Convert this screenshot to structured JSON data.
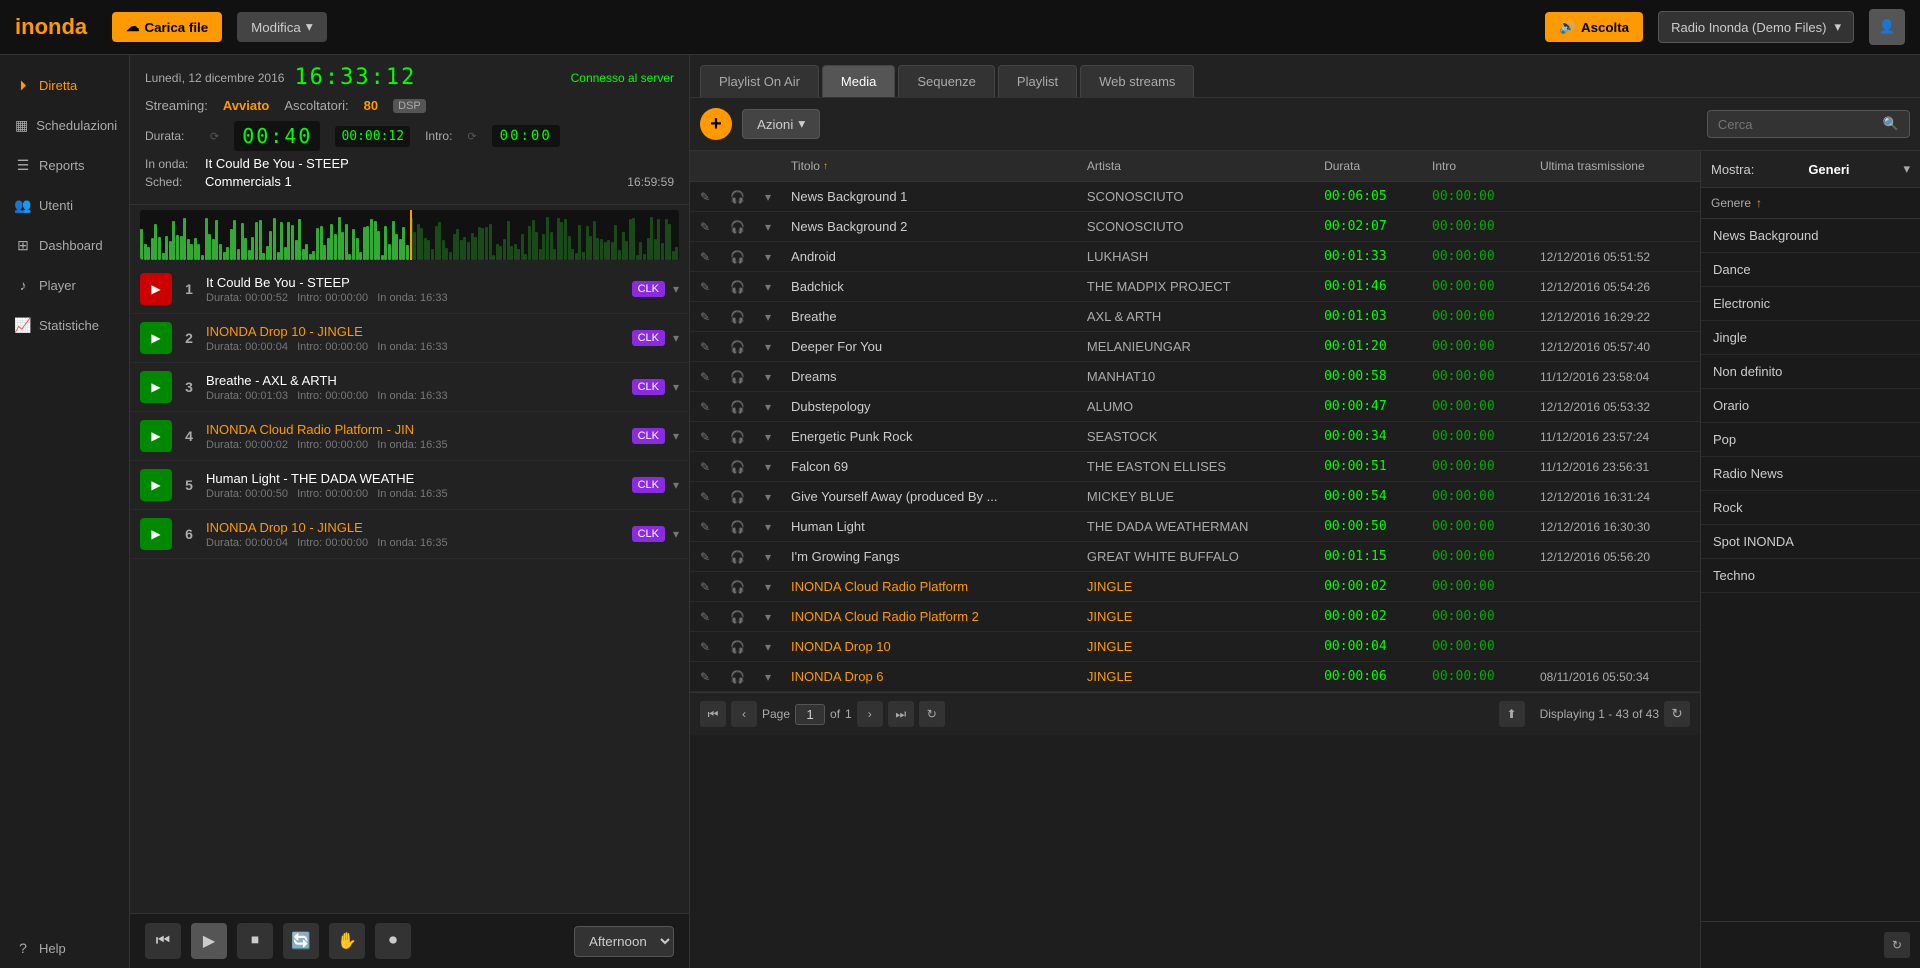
{
  "header": {
    "logo": "inonda",
    "carica_label": "Carica file",
    "modifica_label": "Modifica",
    "ascolta_label": "Ascolta",
    "radio_name": "Radio Inonda (Demo Files)"
  },
  "sidebar": {
    "items": [
      {
        "id": "diretta",
        "label": "Diretta",
        "icon": "▶",
        "active": true
      },
      {
        "id": "schedulazioni",
        "label": "Schedulazioni",
        "icon": "📅"
      },
      {
        "id": "reports",
        "label": "Reports",
        "icon": "📋"
      },
      {
        "id": "utenti",
        "label": "Utenti",
        "icon": "👥"
      },
      {
        "id": "dashboard",
        "label": "Dashboard",
        "icon": "📊"
      },
      {
        "id": "player",
        "label": "Player",
        "icon": "🎵"
      },
      {
        "id": "statistiche",
        "label": "Statistiche",
        "icon": "📈"
      },
      {
        "id": "help",
        "label": "Help",
        "icon": "❓"
      }
    ]
  },
  "left_panel": {
    "date": "Lunedì, 12 dicembre 2016",
    "time": "16:33:12",
    "connected_label": "Connesso al server",
    "streaming_label": "Streaming:",
    "streaming_status": "Avviato",
    "ascoltatori_label": "Ascoltatori:",
    "ascoltatori_val": "80",
    "dsp_label": "DSP",
    "durata_label": "Durata:",
    "durata_val": "00:40",
    "durata_small": "00:00:12",
    "intro_label": "Intro:",
    "intro_val": "00:00",
    "in_onda_label": "In onda:",
    "in_onda_val": "It Could Be You - STEEP",
    "sched_label": "Sched:",
    "sched_val": "Commercials 1",
    "sched_time": "16:59:59"
  },
  "playlist": {
    "items": [
      {
        "num": "1",
        "title": "It Could Be You - STEEP",
        "is_jingle": false,
        "duration": "00:00:52",
        "intro": "00:00:00",
        "on_air": "16:33",
        "has_clk": true,
        "playing": true
      },
      {
        "num": "2",
        "title": "INONDA Drop 10 - JINGLE",
        "is_jingle": true,
        "duration": "00:00:04",
        "intro": "00:00:00",
        "on_air": "16:33",
        "has_clk": true,
        "playing": false
      },
      {
        "num": "3",
        "title": "Breathe - AXL & ARTH",
        "is_jingle": false,
        "duration": "00:01:03",
        "intro": "00:00:00",
        "on_air": "16:33",
        "has_clk": true,
        "playing": false
      },
      {
        "num": "4",
        "title": "INONDA Cloud Radio Platform - JIN",
        "is_jingle": true,
        "duration": "00:00:02",
        "intro": "00:00:00",
        "on_air": "16:35",
        "has_clk": true,
        "playing": false
      },
      {
        "num": "5",
        "title": "Human Light - THE DADA WEATHE",
        "is_jingle": false,
        "duration": "00:00:50",
        "intro": "00:00:00",
        "on_air": "16:35",
        "has_clk": true,
        "playing": false
      },
      {
        "num": "6",
        "title": "INONDA Drop 10 - JINGLE",
        "is_jingle": true,
        "duration": "00:00:04",
        "intro": "00:00:00",
        "on_air": "16:35",
        "has_clk": true,
        "playing": false
      }
    ]
  },
  "transport": {
    "session": "Afternoon",
    "buttons": [
      "⏮",
      "▶",
      "⏹",
      "🔄",
      "✋",
      "⏺"
    ]
  },
  "tabs": {
    "items": [
      {
        "id": "playlist-on-air",
        "label": "Playlist On Air"
      },
      {
        "id": "media",
        "label": "Media",
        "active": true
      },
      {
        "id": "sequenze",
        "label": "Sequenze"
      },
      {
        "id": "playlist",
        "label": "Playlist"
      },
      {
        "id": "web-streams",
        "label": "Web streams"
      }
    ]
  },
  "media": {
    "add_btn": "+",
    "azioni_label": "Azioni",
    "search_placeholder": "Cerca",
    "columns": [
      {
        "id": "actions",
        "label": ""
      },
      {
        "id": "icons",
        "label": ""
      },
      {
        "id": "expand",
        "label": ""
      },
      {
        "id": "title",
        "label": "Titolo",
        "sortable": true,
        "sort_dir": "asc"
      },
      {
        "id": "artist",
        "label": "Artista"
      },
      {
        "id": "duration",
        "label": "Durata"
      },
      {
        "id": "intro",
        "label": "Intro"
      },
      {
        "id": "last_tx",
        "label": "Ultima trasmissione"
      }
    ],
    "rows": [
      {
        "title": "News Background 1",
        "is_jingle": false,
        "artist": "SCONOSCIUTO",
        "duration": "00:06:05",
        "intro": "00:00:00",
        "last_tx": ""
      },
      {
        "title": "News Background 2",
        "is_jingle": false,
        "artist": "SCONOSCIUTO",
        "duration": "00:02:07",
        "intro": "00:00:00",
        "last_tx": ""
      },
      {
        "title": "Android",
        "is_jingle": false,
        "artist": "LUKHASH",
        "duration": "00:01:33",
        "intro": "00:00:00",
        "last_tx": "12/12/2016 05:51:52"
      },
      {
        "title": "Badchick",
        "is_jingle": false,
        "artist": "THE MADPIX PROJECT",
        "duration": "00:01:46",
        "intro": "00:00:00",
        "last_tx": "12/12/2016 05:54:26"
      },
      {
        "title": "Breathe",
        "is_jingle": false,
        "artist": "AXL & ARTH",
        "duration": "00:01:03",
        "intro": "00:00:00",
        "last_tx": "12/12/2016 16:29:22"
      },
      {
        "title": "Deeper For You",
        "is_jingle": false,
        "artist": "MELANIEUNGAR",
        "duration": "00:01:20",
        "intro": "00:00:00",
        "last_tx": "12/12/2016 05:57:40"
      },
      {
        "title": "Dreams",
        "is_jingle": false,
        "artist": "MANHAT10",
        "duration": "00:00:58",
        "intro": "00:00:00",
        "last_tx": "11/12/2016 23:58:04"
      },
      {
        "title": "Dubstepology",
        "is_jingle": false,
        "artist": "ALUMO",
        "duration": "00:00:47",
        "intro": "00:00:00",
        "last_tx": "12/12/2016 05:53:32"
      },
      {
        "title": "Energetic Punk Rock",
        "is_jingle": false,
        "artist": "SEASTOCK",
        "duration": "00:00:34",
        "intro": "00:00:00",
        "last_tx": "11/12/2016 23:57:24"
      },
      {
        "title": "Falcon 69",
        "is_jingle": false,
        "artist": "THE EASTON ELLISES",
        "duration": "00:00:51",
        "intro": "00:00:00",
        "last_tx": "11/12/2016 23:56:31"
      },
      {
        "title": "Give Yourself Away (produced By ...",
        "is_jingle": false,
        "artist": "MICKEY BLUE",
        "duration": "00:00:54",
        "intro": "00:00:00",
        "last_tx": "12/12/2016 16:31:24"
      },
      {
        "title": "Human Light",
        "is_jingle": false,
        "artist": "THE DADA WEATHERMAN",
        "duration": "00:00:50",
        "intro": "00:00:00",
        "last_tx": "12/12/2016 16:30:30"
      },
      {
        "title": "I'm Growing Fangs",
        "is_jingle": false,
        "artist": "GREAT WHITE BUFFALO",
        "duration": "00:01:15",
        "intro": "00:00:00",
        "last_tx": "12/12/2016 05:56:20"
      },
      {
        "title": "INONDA Cloud Radio Platform",
        "is_jingle": true,
        "artist": "JINGLE",
        "duration": "00:00:02",
        "intro": "00:00:00",
        "last_tx": ""
      },
      {
        "title": "INONDA Cloud Radio Platform 2",
        "is_jingle": true,
        "artist": "JINGLE",
        "duration": "00:00:02",
        "intro": "00:00:00",
        "last_tx": ""
      },
      {
        "title": "INONDA Drop 10",
        "is_jingle": true,
        "artist": "JINGLE",
        "duration": "00:00:04",
        "intro": "00:00:00",
        "last_tx": ""
      },
      {
        "title": "INONDA Drop 6",
        "is_jingle": true,
        "artist": "JINGLE",
        "duration": "00:00:06",
        "intro": "00:00:00",
        "last_tx": "08/11/2016 05:50:34"
      }
    ],
    "pagination": {
      "page_label": "Page",
      "current_page": "1",
      "of_label": "of",
      "total_pages": "1",
      "displaying": "Displaying 1 - 43 of 43"
    }
  },
  "genre_panel": {
    "mostra_label": "Mostra:",
    "mostra_val": "Generi",
    "col_header": "Genere",
    "sort_dir": "asc",
    "items": [
      {
        "label": "News Background",
        "active": false
      },
      {
        "label": "Dance",
        "active": false
      },
      {
        "label": "Electronic",
        "active": false
      },
      {
        "label": "Jingle",
        "active": false
      },
      {
        "label": "Non definito",
        "active": false
      },
      {
        "label": "Orario",
        "active": false
      },
      {
        "label": "Pop",
        "active": false
      },
      {
        "label": "Radio News",
        "active": false
      },
      {
        "label": "Rock",
        "active": false
      },
      {
        "label": "Spot INONDA",
        "active": false
      },
      {
        "label": "Techno",
        "active": false
      }
    ]
  }
}
